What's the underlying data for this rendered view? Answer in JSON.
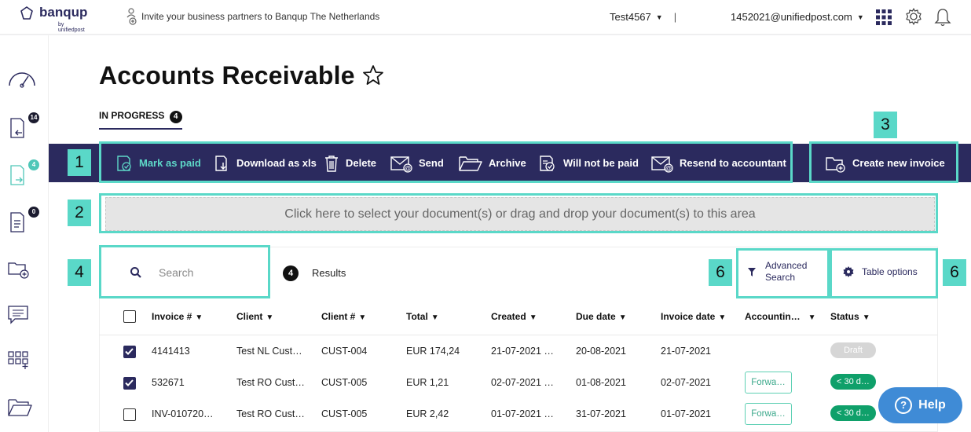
{
  "brand": {
    "name": "banqup",
    "sub": "by unifiedpost"
  },
  "topbar": {
    "invite_text": "Invite your business partners to Banqup The Netherlands",
    "company": "Test4567",
    "separator": "|",
    "user_email": "1452021@unifiedpost.com"
  },
  "sidebar": {
    "badges": {
      "invoices_in": "14",
      "invoices_out": "4",
      "orders": "0"
    }
  },
  "page": {
    "title": "Accounts Receivable",
    "tab_label": "IN PROGRESS",
    "tab_count": "4"
  },
  "actions": {
    "mark_paid": "Mark as paid",
    "download_xls": "Download as xls",
    "delete": "Delete",
    "send": "Send",
    "archive": "Archive",
    "will_not_be_paid": "Will not be paid",
    "resend": "Resend to accountant",
    "create": "Create new invoice"
  },
  "dropzone": {
    "text": "Click here to select your document(s) or drag and drop your document(s) to this area"
  },
  "search": {
    "placeholder": "Search"
  },
  "results": {
    "count": "4",
    "label": "Results"
  },
  "advanced": {
    "line1": "Advanced",
    "line2": "Search"
  },
  "table_options": "Table options",
  "annotations": {
    "n1": "1",
    "n2": "2",
    "n3": "3",
    "n4": "4",
    "n6a": "6",
    "n6b": "6"
  },
  "table": {
    "columns": [
      "Invoice #",
      "Client",
      "Client #",
      "Total",
      "Created",
      "Due date",
      "Invoice date",
      "Accountin…",
      "Status"
    ],
    "rows": [
      {
        "checked": true,
        "invoice": "4141413",
        "client": "Test NL Cust…",
        "client_no": "CUST-004",
        "total": "EUR 174,24",
        "created": "21-07-2021 …",
        "due": "20-08-2021",
        "inv_date": "21-07-2021",
        "accounting": "",
        "status": "Draft"
      },
      {
        "checked": true,
        "invoice": "532671",
        "client": "Test RO Cust…",
        "client_no": "CUST-005",
        "total": "EUR 1,21",
        "created": "02-07-2021 …",
        "due": "01-08-2021",
        "inv_date": "02-07-2021",
        "accounting": "Forwa…",
        "status": "< 30 d…"
      },
      {
        "checked": false,
        "invoice": "INV-010720…",
        "client": "Test RO Cust…",
        "client_no": "CUST-005",
        "total": "EUR 2,42",
        "created": "01-07-2021 …",
        "due": "31-07-2021",
        "inv_date": "01-07-2021",
        "accounting": "Forwa…",
        "status": "< 30 d…"
      }
    ]
  },
  "help": {
    "label": "Help"
  },
  "colors": {
    "navy": "#2b2a5e",
    "teal": "#5ad8c8",
    "green": "#0fa06a",
    "help_blue": "#3f8bd6"
  }
}
